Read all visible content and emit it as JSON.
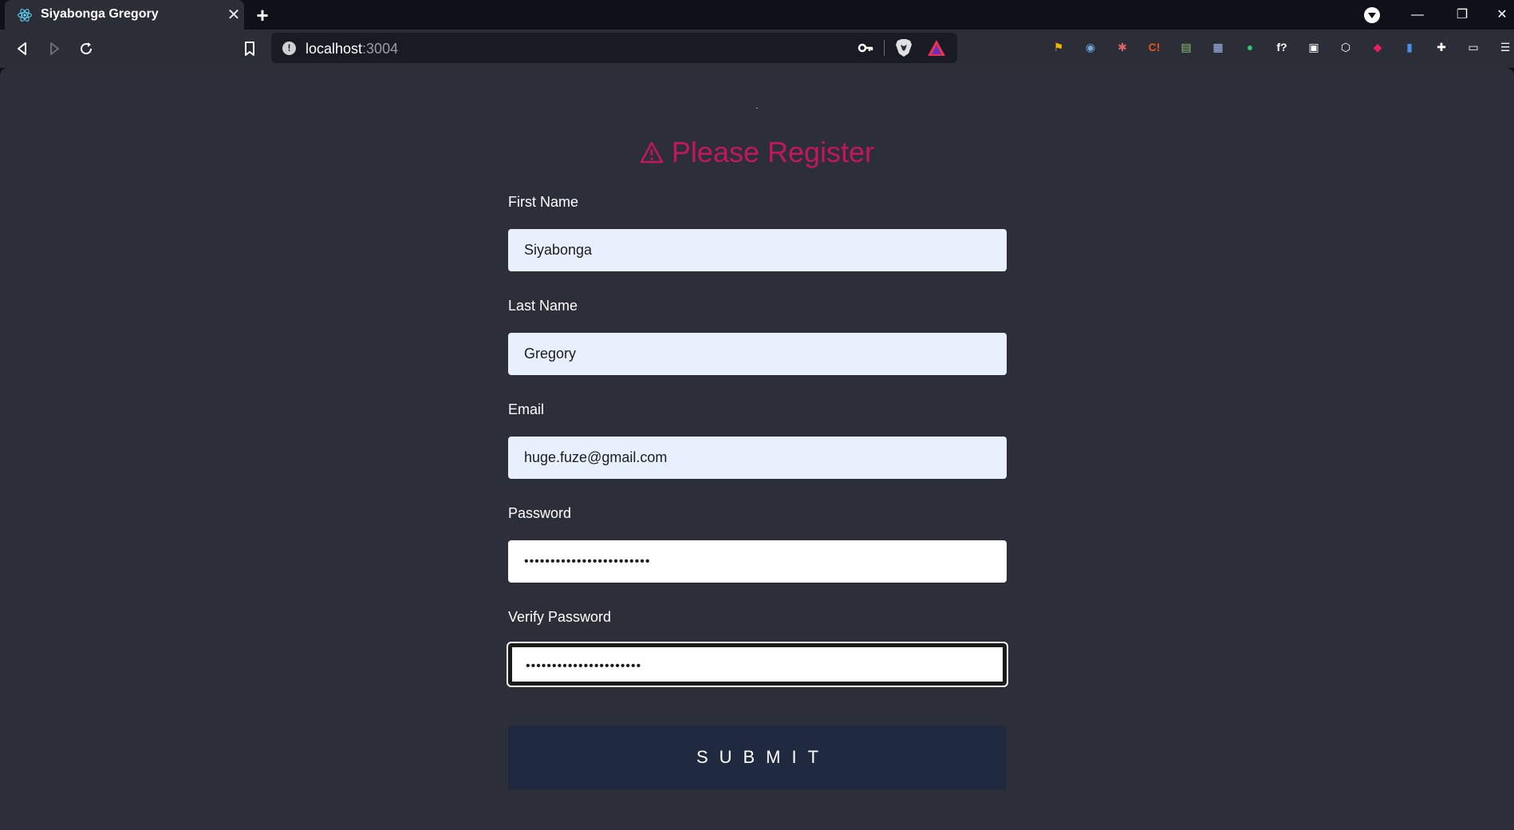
{
  "browser": {
    "tab_title": "Siyabonga Gregory",
    "close_tab": "✕",
    "new_tab": "+",
    "url_host": "localhost",
    "url_port": ":3004",
    "window_controls": {
      "minimize": "—",
      "restore": "❐",
      "close": "✕"
    }
  },
  "extensions": [
    {
      "name": "flag-extension-icon",
      "glyph": "⚑",
      "color": "#f2b705"
    },
    {
      "name": "ring-extension-icon",
      "glyph": "◉",
      "color": "#6fa8dc"
    },
    {
      "name": "paw-extension-icon",
      "glyph": "✱",
      "color": "#e06666"
    },
    {
      "name": "c-extension-icon",
      "glyph": "C!",
      "color": "#e8531f"
    },
    {
      "name": "green-extension-icon",
      "glyph": "▤",
      "color": "#93c47d"
    },
    {
      "name": "sheet-extension-icon",
      "glyph": "▦",
      "color": "#a4c2f4"
    },
    {
      "name": "bot-extension-icon",
      "glyph": "●",
      "color": "#38c172"
    },
    {
      "name": "formula-extension-icon",
      "glyph": "f?",
      "color": "#ffffff"
    },
    {
      "name": "qr-extension-icon",
      "glyph": "▣",
      "color": "#ffffff"
    },
    {
      "name": "cube-extension-icon",
      "glyph": "⬡",
      "color": "#ffffff"
    },
    {
      "name": "colors-extension-icon",
      "glyph": "◆",
      "color": "#e91e63"
    },
    {
      "name": "docs-extension-icon",
      "glyph": "▮",
      "color": "#4a90e2"
    },
    {
      "name": "puzzle-extension-icon",
      "glyph": "✚",
      "color": "#ffffff"
    },
    {
      "name": "wallet-extension-icon",
      "glyph": "▭",
      "color": "#ffffff"
    },
    {
      "name": "menu-icon",
      "glyph": "☰",
      "color": "#ffffff"
    }
  ],
  "form": {
    "title": "Please Register",
    "fields": [
      {
        "label": "First Name",
        "value": "Siyabonga"
      },
      {
        "label": "Last Name",
        "value": "Gregory"
      },
      {
        "label": "Email",
        "value": "huge.fuze@gmail.com"
      },
      {
        "label": "Password",
        "value": "••••••••••••••••••••••••"
      },
      {
        "label": "Verify Password",
        "value": "••••••••••••••••••••••"
      }
    ],
    "submit_label": "SUBMIT"
  },
  "colors": {
    "accent": "#c2185b",
    "page_bg": "#2c2e39",
    "button_bg": "#1f2940",
    "autofill_bg": "#e8f0fe"
  }
}
